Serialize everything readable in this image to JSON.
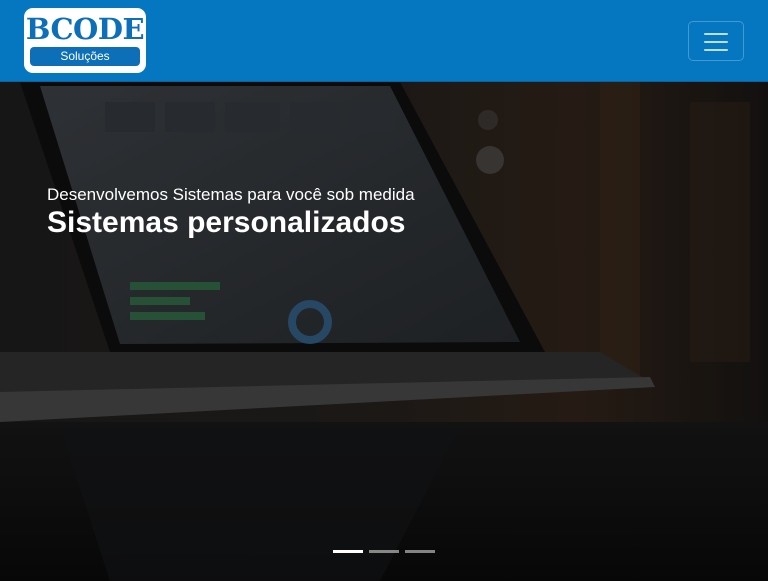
{
  "navbar": {
    "logo_text": "BCODE",
    "logo_subtitle": "Soluções",
    "toggler_icon": "hamburger-menu-icon",
    "background_color": "#0577c1"
  },
  "carousel": {
    "slides": [
      {
        "subtitle": "Desenvolvemos Sistemas para você sob medida",
        "title": "Sistemas personalizados"
      }
    ],
    "indicator_count": 3,
    "active_index": 0,
    "background_description_icon": "laptop-dashboard-photo"
  }
}
